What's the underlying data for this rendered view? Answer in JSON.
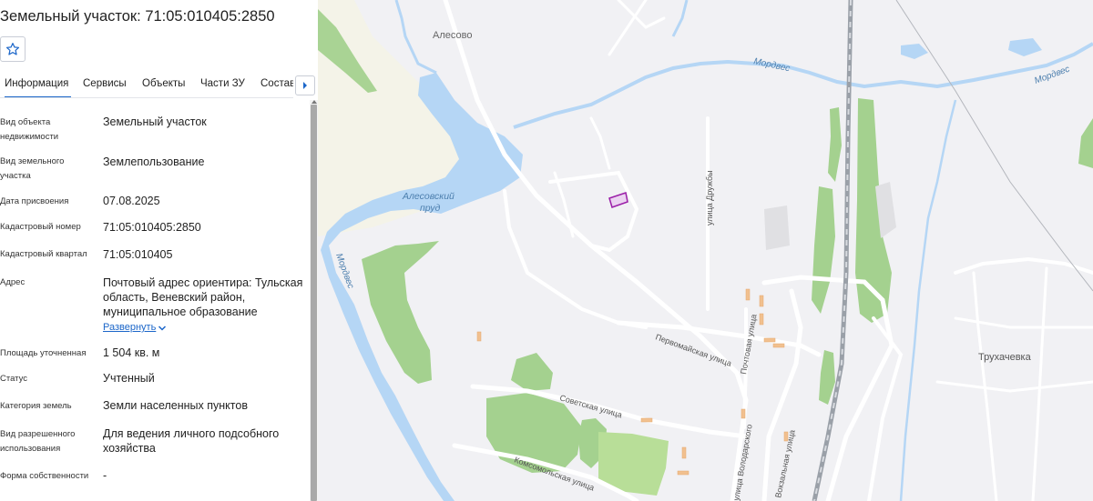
{
  "header": {
    "title": "Земельный участок: 71:05:010405:2850"
  },
  "tabs": [
    {
      "label": "Информация",
      "active": true
    },
    {
      "label": "Сервисы"
    },
    {
      "label": "Объекты"
    },
    {
      "label": "Части ЗУ"
    },
    {
      "label": "Состав"
    }
  ],
  "fields": [
    {
      "label": "Вид объекта недвижимости",
      "value": "Земельный участок"
    },
    {
      "label": "Вид земельного участка",
      "value": "Землепользование"
    },
    {
      "label": "Дата присвоения",
      "value": "07.08.2025"
    },
    {
      "label": "Кадастровый номер",
      "value": "71:05:010405:2850"
    },
    {
      "label": "Кадастровый квартал",
      "value": "71:05:010405"
    },
    {
      "label": "Адрес",
      "value": "Почтовый адрес ориентира: Тульская область, Веневский район, муниципальное образование"
    },
    {
      "label": "Площадь уточненная",
      "value": "1 504 кв. м"
    },
    {
      "label": "Статус",
      "value": "Учтенный"
    },
    {
      "label": "Категория земель",
      "value": "Земли населенных пунктов"
    },
    {
      "label": "Вид разрешенного использования",
      "value": "Для ведения личного подсобного хозяйства"
    },
    {
      "label": "Форма собственности",
      "value": "-"
    }
  ],
  "address_expand": "Развернуть",
  "map": {
    "places": [
      "Алесово",
      "Трухачевка"
    ],
    "pond": [
      "Алесовский",
      "пруд"
    ],
    "rivers": [
      "Мордвес",
      "Мордвес",
      "Мордвес"
    ],
    "streets": [
      "улица Дружбы",
      "Первомайская улица",
      "Почтовая улица",
      "Советская улица",
      "Комсомольская улица",
      "улица Володарского",
      "Вокзальная улица"
    ]
  },
  "colors": {
    "accent": "#1b66c9",
    "parcel": "#9b1fa8",
    "water": "#b5d6f5",
    "forest": "#a4d18f",
    "road": "#ffffff",
    "railway": "#9aa0a8"
  }
}
